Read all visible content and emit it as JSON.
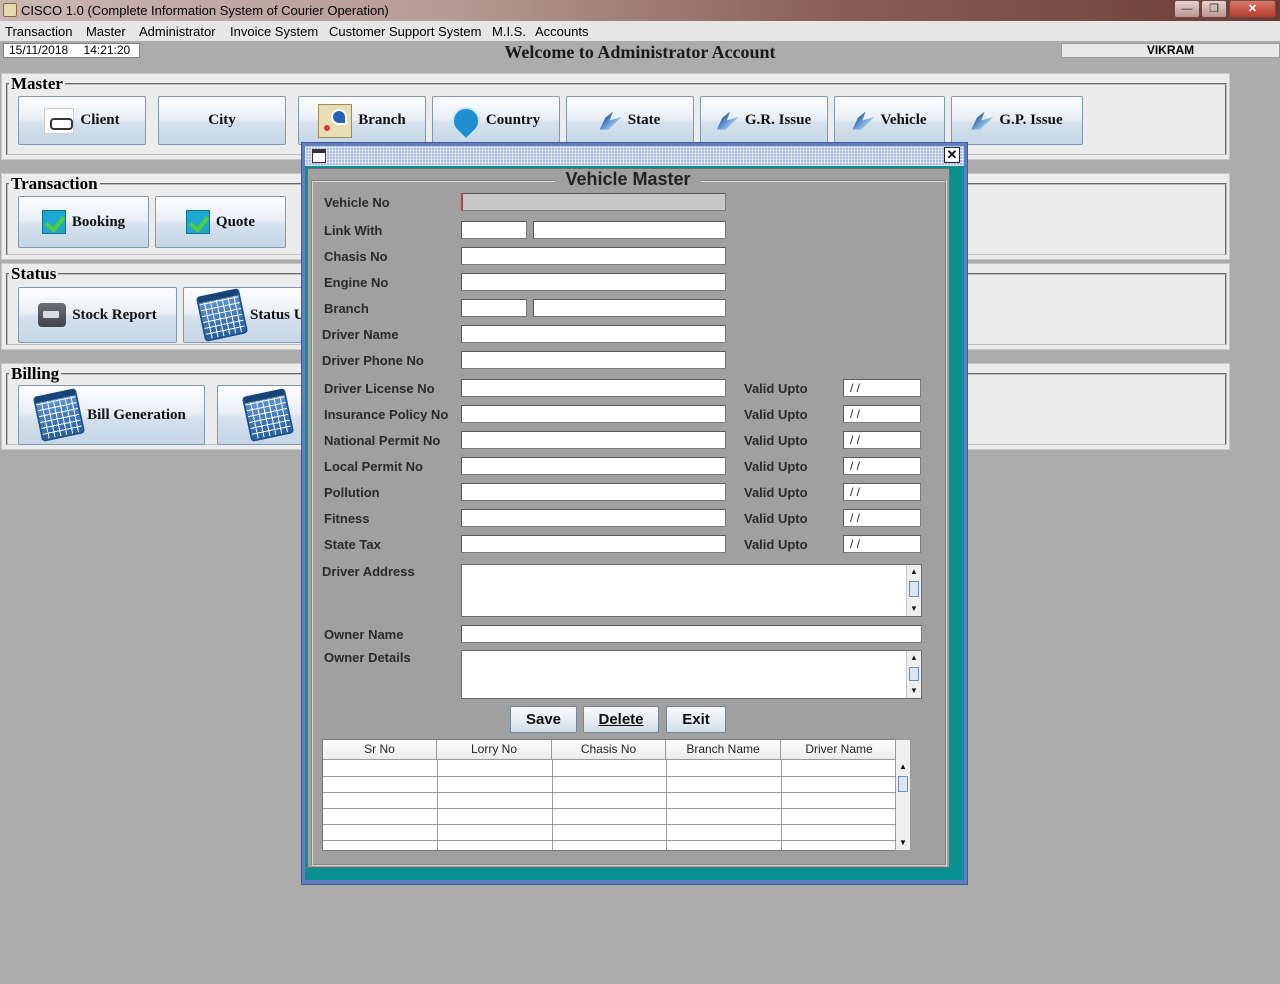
{
  "window": {
    "title": "CISCO 1.0 (Complete Information System of Courier Operation)",
    "minimize": "—",
    "restore": "❐",
    "close": "✕"
  },
  "menu": [
    "Transaction",
    "Master",
    "Administrator",
    "Invoice System",
    "Customer Support System",
    "M.I.S.",
    "Accounts"
  ],
  "status": {
    "date": "15/11/2018",
    "time": "14:21:20",
    "welcome": "Welcome to Administrator Account",
    "user": "VIKRAM"
  },
  "sections": {
    "master": {
      "legend": "Master",
      "buttons": [
        {
          "label": "Client",
          "icon": "handshake-icon"
        },
        {
          "label": "City",
          "icon": ""
        },
        {
          "label": "Branch",
          "icon": "map-icon"
        },
        {
          "label": "Country",
          "icon": "location-pin-icon"
        },
        {
          "label": "State",
          "icon": "bird-icon"
        },
        {
          "label": "G.R. Issue",
          "icon": "bird-icon"
        },
        {
          "label": "Vehicle",
          "icon": "bird-icon"
        },
        {
          "label": "G.P. Issue",
          "icon": "bird-icon"
        }
      ]
    },
    "transaction": {
      "legend": "Transaction",
      "buttons": [
        {
          "label": "Booking",
          "icon": "checkmark-icon"
        },
        {
          "label": "Quote",
          "icon": "checkmark-icon"
        }
      ]
    },
    "status": {
      "legend": "Status",
      "buttons": [
        {
          "label": "Stock Report",
          "icon": "truck-icon"
        },
        {
          "label": "Status U",
          "icon": "calendar-icon"
        }
      ]
    },
    "billing": {
      "legend": "Billing",
      "buttons": [
        {
          "label": "Bill Generation",
          "icon": "calendar-icon"
        },
        {
          "label": "",
          "icon": "calendar-icon"
        }
      ]
    }
  },
  "vehicle_master": {
    "title": "Vehicle Master",
    "labels": {
      "vehicle_no": "Vehicle No",
      "link_with": "Link With",
      "chasis_no": "Chasis No",
      "engine_no": "Engine No",
      "branch": "Branch",
      "driver_name": "Driver Name",
      "driver_phone": "Driver Phone No",
      "driver_license": "Driver License No",
      "insurance": "Insurance Policy No",
      "national_permit": "National Permit No",
      "local_permit": "Local Permit No",
      "pollution": "Pollution",
      "fitness": "Fitness",
      "state_tax": "State Tax",
      "driver_address": "Driver Address",
      "owner_name": "Owner Name",
      "owner_details": "Owner Details",
      "valid_upto": "Valid Upto"
    },
    "date_placeholder": "/ /",
    "buttons": {
      "save": "Save",
      "delete": "Delete",
      "exit": "Exit"
    },
    "table": {
      "columns": [
        "Sr No",
        "Lorry No",
        "Chasis No",
        "Branch Name",
        "Driver Name"
      ],
      "rows": []
    },
    "accent": "#07908f",
    "frame_color": "#5f7fc0"
  }
}
